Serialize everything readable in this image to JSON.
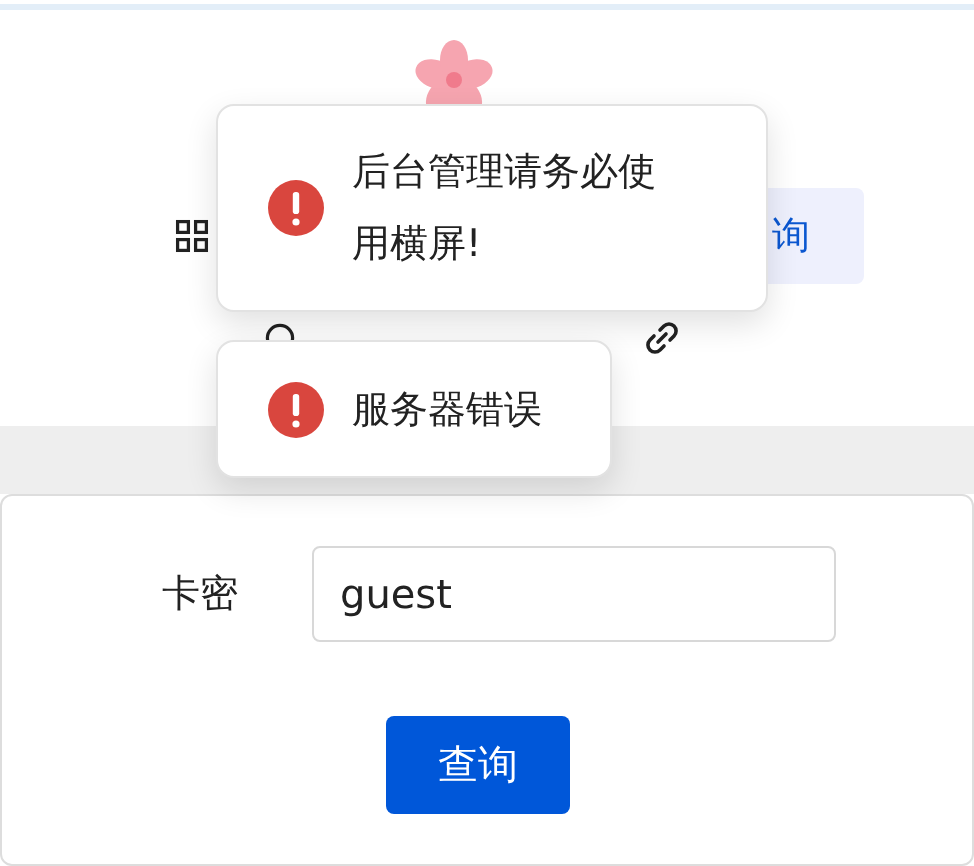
{
  "menu": {
    "row_1": {
      "tab": {
        "label": "询",
        "selected": true
      }
    }
  },
  "form": {
    "field": {
      "label": "卡密",
      "value": "guest"
    },
    "submit": "查询"
  },
  "toasts": [
    {
      "kind": "error",
      "message": "后台管理请务必使用横屏!"
    },
    {
      "kind": "error",
      "message": "服务器错误"
    }
  ]
}
